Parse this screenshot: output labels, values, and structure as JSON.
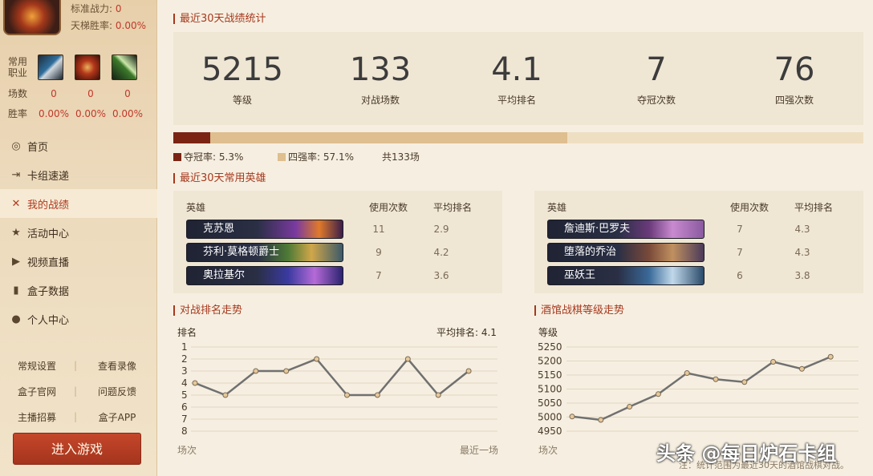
{
  "profile": {
    "power_label": "标准战力:",
    "power_value": "0",
    "ladder_label": "天梯胜率:",
    "ladder_value": "0.00%"
  },
  "classes": {
    "label": "常用职业",
    "icons": [
      "warrior-class-icon",
      "demon-hunter-class-icon",
      "hunter-class-icon"
    ],
    "games_label": "场数",
    "games": [
      "0",
      "0",
      "0"
    ],
    "winrate_label": "胜率",
    "winrates": [
      "0.00%",
      "0.00%",
      "0.00%"
    ]
  },
  "nav": [
    {
      "label": "首页",
      "icon": "swirl-icon",
      "glyph": "◎"
    },
    {
      "label": "卡组速递",
      "icon": "deck-icon",
      "glyph": "⇥"
    },
    {
      "label": "我的战绩",
      "icon": "crossed-swords-icon",
      "glyph": "✕",
      "active": true
    },
    {
      "label": "活动中心",
      "icon": "star-icon",
      "glyph": "★"
    },
    {
      "label": "视频直播",
      "icon": "video-icon",
      "glyph": "▶"
    },
    {
      "label": "盒子数据",
      "icon": "bar-chart-icon",
      "glyph": "▮"
    },
    {
      "label": "个人中心",
      "icon": "user-icon",
      "glyph": "●"
    }
  ],
  "sub_links": [
    [
      "常规设置",
      "查看录像"
    ],
    [
      "盒子官网",
      "问题反馈"
    ],
    [
      "主播招募",
      "盒子APP"
    ]
  ],
  "play_button": "进入游戏",
  "stats_title": "最近30天战绩统计",
  "stats": [
    {
      "value": "5215",
      "label": "等级"
    },
    {
      "value": "133",
      "label": "对战场数"
    },
    {
      "value": "4.1",
      "label": "平均排名"
    },
    {
      "value": "7",
      "label": "夺冠次数"
    },
    {
      "value": "76",
      "label": "四强次数"
    }
  ],
  "rate_bar": {
    "champion_rate": 0.053,
    "top4_rate": 0.571,
    "champion_label": "夺冠率:",
    "champion_text": "5.3%",
    "top4_label": "四强率:",
    "top4_text": "57.1%",
    "total_text": "共133场",
    "champion_color": "#7b2414",
    "top4_color": "#dfbe8f"
  },
  "heroes_title": "最近30天常用英雄",
  "hero_headers": {
    "hero": "英雄",
    "count": "使用次数",
    "rank": "平均排名"
  },
  "heroes_left": [
    {
      "name": "克苏恩",
      "count": "11",
      "rank": "2.9"
    },
    {
      "name": "芬利·莫格顿爵士",
      "count": "9",
      "rank": "4.2"
    },
    {
      "name": "奥拉基尔",
      "count": "7",
      "rank": "3.6"
    }
  ],
  "heroes_right": [
    {
      "name": "詹迪斯·巴罗夫",
      "count": "7",
      "rank": "4.3"
    },
    {
      "name": "堕落的乔治",
      "count": "7",
      "rank": "4.3"
    },
    {
      "name": "巫妖王",
      "count": "6",
      "rank": "3.8"
    }
  ],
  "rank_chart_title": "对战排名走势",
  "level_chart_title": "酒馆战棋等级走势",
  "chart_data": [
    {
      "type": "line",
      "ylabel": "排名",
      "annotation": "平均排名: 4.1",
      "x_start_label": "场次",
      "x_end_label": "最近一场",
      "ylim": [
        1,
        8
      ],
      "y_inverted": true,
      "yticks": [
        1,
        2,
        3,
        4,
        5,
        6,
        7,
        8
      ],
      "values": [
        4,
        5,
        3,
        3,
        2,
        5,
        5,
        2,
        5,
        3
      ]
    },
    {
      "type": "line",
      "ylabel": "等级",
      "x_start_label": "场次",
      "ylim": [
        4950,
        5250
      ],
      "yticks": [
        4950,
        5000,
        5050,
        5100,
        5150,
        5200,
        5250
      ],
      "values": [
        5002,
        4990,
        5037,
        5082,
        5157,
        5135,
        5125,
        5197,
        5172,
        5215
      ]
    }
  ],
  "footnote": "注：统计范围为最近30天的酒馆战棋对战。",
  "watermark": "头条 @每日炉石卡组"
}
